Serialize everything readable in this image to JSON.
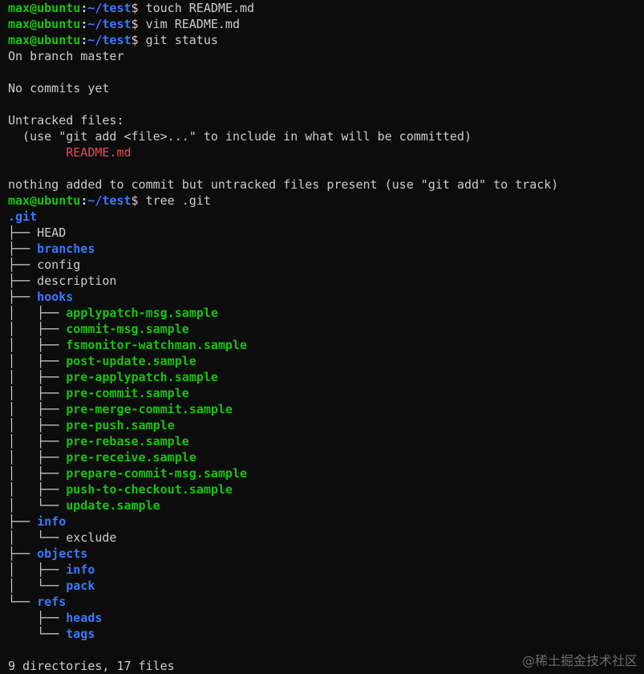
{
  "prompt": {
    "user": "max@ubuntu",
    "separator": ":",
    "path": "~/test",
    "symbol": "$"
  },
  "colors": {
    "background": "#0c0c0c",
    "foreground": "#cccccc",
    "prompt_green": "#16c60c",
    "directory_blue": "#3b78ff",
    "untracked_red": "#e74856"
  },
  "lines": [
    {
      "type": "prompt",
      "command": " touch README.md"
    },
    {
      "type": "prompt",
      "command": " vim README.md"
    },
    {
      "type": "prompt",
      "command": " git status"
    },
    {
      "type": "text",
      "segments": [
        {
          "cls": "plain",
          "text": "On branch master"
        }
      ]
    },
    {
      "type": "text",
      "segments": [
        {
          "cls": "plain",
          "text": ""
        }
      ]
    },
    {
      "type": "text",
      "segments": [
        {
          "cls": "plain",
          "text": "No commits yet"
        }
      ]
    },
    {
      "type": "text",
      "segments": [
        {
          "cls": "plain",
          "text": ""
        }
      ]
    },
    {
      "type": "text",
      "segments": [
        {
          "cls": "plain",
          "text": "Untracked files:"
        }
      ]
    },
    {
      "type": "text",
      "segments": [
        {
          "cls": "plain",
          "text": "  (use \"git add <file>...\" to include in what will be committed)"
        }
      ]
    },
    {
      "type": "text",
      "segments": [
        {
          "cls": "red",
          "text": "        README.md"
        }
      ]
    },
    {
      "type": "text",
      "segments": [
        {
          "cls": "plain",
          "text": ""
        }
      ]
    },
    {
      "type": "text",
      "segments": [
        {
          "cls": "plain",
          "text": "nothing added to commit but untracked files present (use \"git add\" to track)"
        }
      ]
    },
    {
      "type": "prompt",
      "command": " tree .git"
    },
    {
      "type": "tree",
      "branch": "",
      "name": ".git",
      "kind": "dir"
    },
    {
      "type": "tree",
      "branch": "├── ",
      "name": "HEAD",
      "kind": "file"
    },
    {
      "type": "tree",
      "branch": "├── ",
      "name": "branches",
      "kind": "dir"
    },
    {
      "type": "tree",
      "branch": "├── ",
      "name": "config",
      "kind": "file"
    },
    {
      "type": "tree",
      "branch": "├── ",
      "name": "description",
      "kind": "file"
    },
    {
      "type": "tree",
      "branch": "├── ",
      "name": "hooks",
      "kind": "dir"
    },
    {
      "type": "tree",
      "branch": "│   ├── ",
      "name": "applypatch-msg.sample",
      "kind": "exec"
    },
    {
      "type": "tree",
      "branch": "│   ├── ",
      "name": "commit-msg.sample",
      "kind": "exec"
    },
    {
      "type": "tree",
      "branch": "│   ├── ",
      "name": "fsmonitor-watchman.sample",
      "kind": "exec"
    },
    {
      "type": "tree",
      "branch": "│   ├── ",
      "name": "post-update.sample",
      "kind": "exec"
    },
    {
      "type": "tree",
      "branch": "│   ├── ",
      "name": "pre-applypatch.sample",
      "kind": "exec"
    },
    {
      "type": "tree",
      "branch": "│   ├── ",
      "name": "pre-commit.sample",
      "kind": "exec"
    },
    {
      "type": "tree",
      "branch": "│   ├── ",
      "name": "pre-merge-commit.sample",
      "kind": "exec"
    },
    {
      "type": "tree",
      "branch": "│   ├── ",
      "name": "pre-push.sample",
      "kind": "exec"
    },
    {
      "type": "tree",
      "branch": "│   ├── ",
      "name": "pre-rebase.sample",
      "kind": "exec"
    },
    {
      "type": "tree",
      "branch": "│   ├── ",
      "name": "pre-receive.sample",
      "kind": "exec"
    },
    {
      "type": "tree",
      "branch": "│   ├── ",
      "name": "prepare-commit-msg.sample",
      "kind": "exec"
    },
    {
      "type": "tree",
      "branch": "│   ├── ",
      "name": "push-to-checkout.sample",
      "kind": "exec"
    },
    {
      "type": "tree",
      "branch": "│   └── ",
      "name": "update.sample",
      "kind": "exec"
    },
    {
      "type": "tree",
      "branch": "├── ",
      "name": "info",
      "kind": "dir"
    },
    {
      "type": "tree",
      "branch": "│   └── ",
      "name": "exclude",
      "kind": "file"
    },
    {
      "type": "tree",
      "branch": "├── ",
      "name": "objects",
      "kind": "dir"
    },
    {
      "type": "tree",
      "branch": "│   ├── ",
      "name": "info",
      "kind": "dir"
    },
    {
      "type": "tree",
      "branch": "│   └── ",
      "name": "pack",
      "kind": "dir"
    },
    {
      "type": "tree",
      "branch": "└── ",
      "name": "refs",
      "kind": "dir"
    },
    {
      "type": "tree",
      "branch": "    ├── ",
      "name": "heads",
      "kind": "dir"
    },
    {
      "type": "tree",
      "branch": "    └── ",
      "name": "tags",
      "kind": "dir"
    },
    {
      "type": "text",
      "segments": [
        {
          "cls": "plain",
          "text": ""
        }
      ]
    },
    {
      "type": "text",
      "segments": [
        {
          "cls": "plain",
          "text": "9 directories, 17 files"
        }
      ]
    }
  ],
  "watermark": "@稀土掘金技术社区"
}
